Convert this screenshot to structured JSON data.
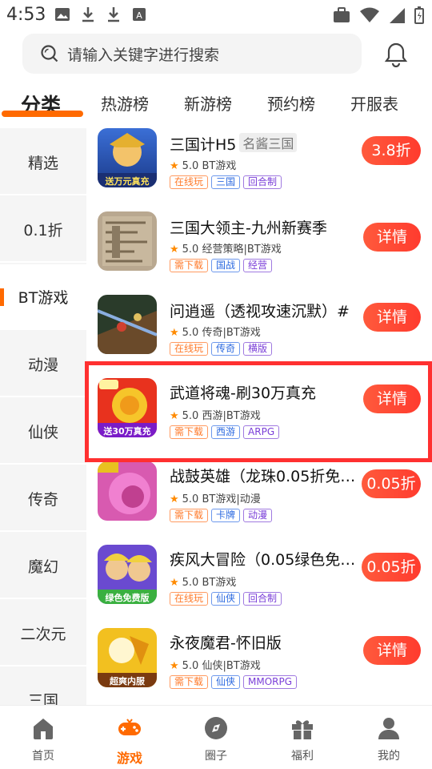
{
  "status_bar": {
    "time": "4:53"
  },
  "search": {
    "placeholder": "请输入关键字进行搜索"
  },
  "tabs": [
    {
      "label": "分类",
      "active": true
    },
    {
      "label": "热游榜"
    },
    {
      "label": "新游榜"
    },
    {
      "label": "预约榜"
    },
    {
      "label": "开服表"
    }
  ],
  "sidebar": {
    "items": [
      {
        "label": "精选"
      },
      {
        "label": "0.1折"
      },
      {
        "label": "BT游戏",
        "active": true
      },
      {
        "label": "动漫"
      },
      {
        "label": "仙侠"
      },
      {
        "label": "传奇"
      },
      {
        "label": "魔幻"
      },
      {
        "label": "二次元"
      },
      {
        "label": "三国"
      }
    ]
  },
  "games": [
    {
      "name": "三国计H5",
      "alias": "名酱三国",
      "rating": "5.0",
      "category": "BT游戏",
      "tags": [
        "在线玩",
        "三国",
        "回合制"
      ],
      "action": "3.8折",
      "icon_text": "送万元真充"
    },
    {
      "name": "三国大领主-九州新赛季",
      "rating": "5.0",
      "category": "经营策略|BT游戏",
      "tags": [
        "需下载",
        "国战",
        "经营"
      ],
      "action": "详情"
    },
    {
      "name": "问逍遥（透视攻速沉默）#",
      "rating": "5.0",
      "category": "传奇|BT游戏",
      "tags": [
        "在线玩",
        "传奇",
        "横版"
      ],
      "action": "详情"
    },
    {
      "name": "武道将魂-刷30万真充",
      "rating": "5.0",
      "category": "西游|BT游戏",
      "tags": [
        "需下载",
        "西游",
        "ARPG"
      ],
      "action": "详情",
      "icon_text": "送30万真充"
    },
    {
      "name": "战鼓英雄（龙珠0.05折免…",
      "rating": "5.0",
      "category": "BT游戏|动漫",
      "tags": [
        "需下载",
        "卡牌",
        "动漫"
      ],
      "action": "0.05折"
    },
    {
      "name": "疾风大冒险（0.05绿色免…",
      "rating": "5.0",
      "category": "BT游戏",
      "tags": [
        "在线玩",
        "仙侠",
        "回合制"
      ],
      "action": "0.05折",
      "icon_text": "绿色免费版"
    },
    {
      "name": "永夜魔君-怀旧版",
      "rating": "5.0",
      "category": "仙侠|BT游戏",
      "tags": [
        "需下载",
        "仙侠",
        "MMORPG"
      ],
      "action": "详情",
      "icon_text": "超爽内服"
    }
  ],
  "bottom_nav": [
    {
      "label": "首页",
      "icon": "home-icon"
    },
    {
      "label": "游戏",
      "icon": "gamepad-icon",
      "active": true
    },
    {
      "label": "圈子",
      "icon": "compass-icon"
    },
    {
      "label": "福利",
      "icon": "gift-icon"
    },
    {
      "label": "我的",
      "icon": "user-icon"
    }
  ],
  "colors": {
    "accent": "#ff6a00",
    "button": "#ff4432",
    "highlight": "#ff3030"
  }
}
